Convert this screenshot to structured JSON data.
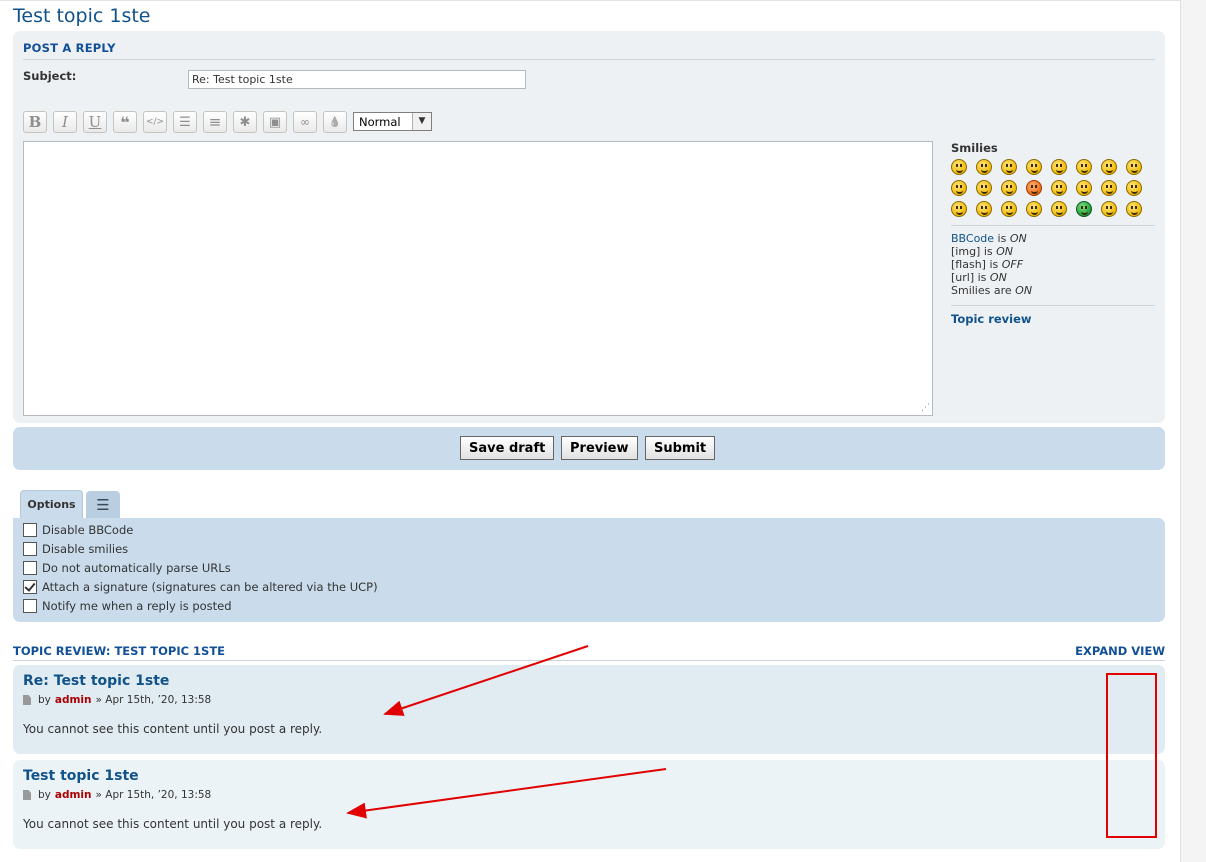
{
  "page_title": "Test topic 1ste",
  "form": {
    "heading": "Post a reply",
    "subject_label": "Subject:",
    "subject_value": "Re: Test topic 1ste",
    "font_size_value": "Normal"
  },
  "toolbar_icons": [
    "bold-icon",
    "italic-icon",
    "underline-icon",
    "quote-icon",
    "code-icon",
    "list-icon",
    "numbered-list-icon",
    "list-item-icon",
    "image-icon",
    "link-icon",
    "color-icon"
  ],
  "toolbar_glyphs": {
    "bold": "B",
    "italic": "I",
    "underline": "U",
    "quote": "❝",
    "code": "</>",
    "list": "☰",
    "numbered": "≡",
    "item": "✱",
    "image": "▣",
    "link": "∞",
    "color": "💧"
  },
  "sidebar": {
    "smilies_title": "Smilies",
    "bbcode_link": "BBCode",
    "bbcode_is": " is ",
    "bbcode_state": "ON",
    "img_label": "[img] is ",
    "img_state": "ON",
    "flash_label": "[flash] is ",
    "flash_state": "OFF",
    "url_label": "[url] is ",
    "url_state": "ON",
    "smilies_label": "Smilies are ",
    "smilies_state": "ON",
    "topic_review_link": "Topic review"
  },
  "buttons": {
    "save_draft": "Save draft",
    "preview": "Preview",
    "submit": "Submit"
  },
  "tabs": {
    "options": "Options",
    "menu_glyph": "☰"
  },
  "options": [
    {
      "label": "Disable BBCode",
      "checked": false
    },
    {
      "label": "Disable smilies",
      "checked": false
    },
    {
      "label": "Do not automatically parse URLs",
      "checked": false
    },
    {
      "label": "Attach a signature (signatures can be altered via the UCP)",
      "checked": true
    },
    {
      "label": "Notify me when a reply is posted",
      "checked": false
    }
  ],
  "review": {
    "heading": "Topic review: Test topic 1ste",
    "expand_view": "Expand view",
    "posts": [
      {
        "title": "Re: Test topic 1ste",
        "by": "by",
        "author": "admin",
        "date": "» Apr 15th, ’20, 13:58",
        "content": "You cannot see this content until you post a reply."
      },
      {
        "title": "Test topic 1ste",
        "by": "by",
        "author": "admin",
        "date": "» Apr 15th, ’20, 13:58",
        "content": "You cannot see this content until you post a reply."
      }
    ]
  },
  "colors": {
    "link": "#105289",
    "panel": "#eef1f4",
    "panel_blue": "#cadceb",
    "author": "#aa0000",
    "annotation": "#e00000"
  }
}
